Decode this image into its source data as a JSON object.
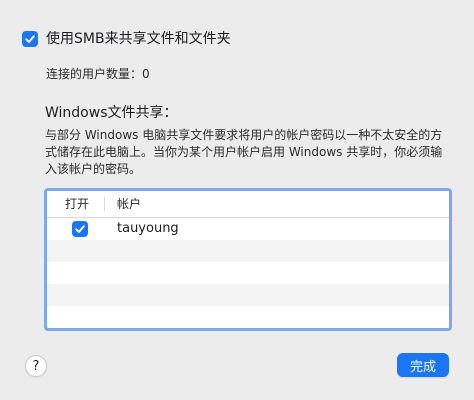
{
  "smb": {
    "checked": true,
    "label": "使用SMB来共享文件和文件夹"
  },
  "connected_users": {
    "label": "连接的用户数量：",
    "value": "0"
  },
  "windows_sharing": {
    "title": "Windows文件共享：",
    "description": "与部分 Windows 电脑共享文件要求将用户的帐户密码以一种不太安全的方式储存在此电脑上。当你为某个用户帐户启用 Windows 共享时，你必须输入该帐户的密码。"
  },
  "table": {
    "col_open": "打开",
    "col_account": "帐户",
    "rows": [
      {
        "checked": true,
        "account": "tauyoung"
      }
    ]
  },
  "buttons": {
    "help": "?",
    "done": "完成"
  },
  "colors": {
    "accent": "#1a76f2",
    "focus_ring": "#7fa9e8",
    "background": "#ececec"
  },
  "icons": {
    "checkbox": "checkmark-icon"
  }
}
